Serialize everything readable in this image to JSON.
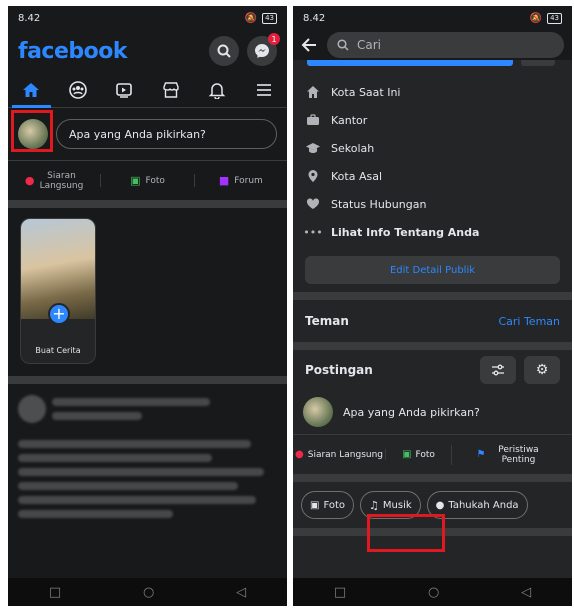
{
  "left": {
    "status": {
      "time": "8.42",
      "battery": "43"
    },
    "header": {
      "logo": "facebook",
      "messenger_badge": "1"
    },
    "composer": {
      "placeholder": "Apa yang Anda pikirkan?"
    },
    "actions": [
      {
        "label": "Siaran Langsung",
        "color": "#f02849"
      },
      {
        "label": "Foto",
        "color": "#45bd62"
      },
      {
        "label": "Forum",
        "color": "#a033ff"
      }
    ],
    "story": {
      "label": "Buat Cerita"
    }
  },
  "right": {
    "status": {
      "time": "8.42",
      "battery": "43"
    },
    "search": {
      "placeholder": "Cari"
    },
    "info_items": [
      {
        "label": "Kota Saat Ini",
        "icon": "house-icon"
      },
      {
        "label": "Kantor",
        "icon": "briefcase-icon"
      },
      {
        "label": "Sekolah",
        "icon": "graduation-cap-icon"
      },
      {
        "label": "Kota Asal",
        "icon": "location-pin-icon"
      },
      {
        "label": "Status Hubungan",
        "icon": "heart-icon"
      }
    ],
    "see_more": "Lihat Info Tentang Anda",
    "edit_button": "Edit Detail Publik",
    "friends": {
      "title": "Teman",
      "link": "Cari Teman"
    },
    "posts": {
      "title": "Postingan"
    },
    "composer": {
      "placeholder": "Apa yang Anda pikirkan?"
    },
    "actions": [
      {
        "label": "Siaran Langsung"
      },
      {
        "label": "Foto"
      },
      {
        "label": "Peristiwa Penting"
      }
    ],
    "chips": [
      {
        "label": "Foto"
      },
      {
        "label": "Musik"
      },
      {
        "label": "Tahukah Anda"
      }
    ]
  },
  "colors": {
    "accent": "#2d88ff",
    "highlight": "#e0181f",
    "background": "#18191a"
  }
}
